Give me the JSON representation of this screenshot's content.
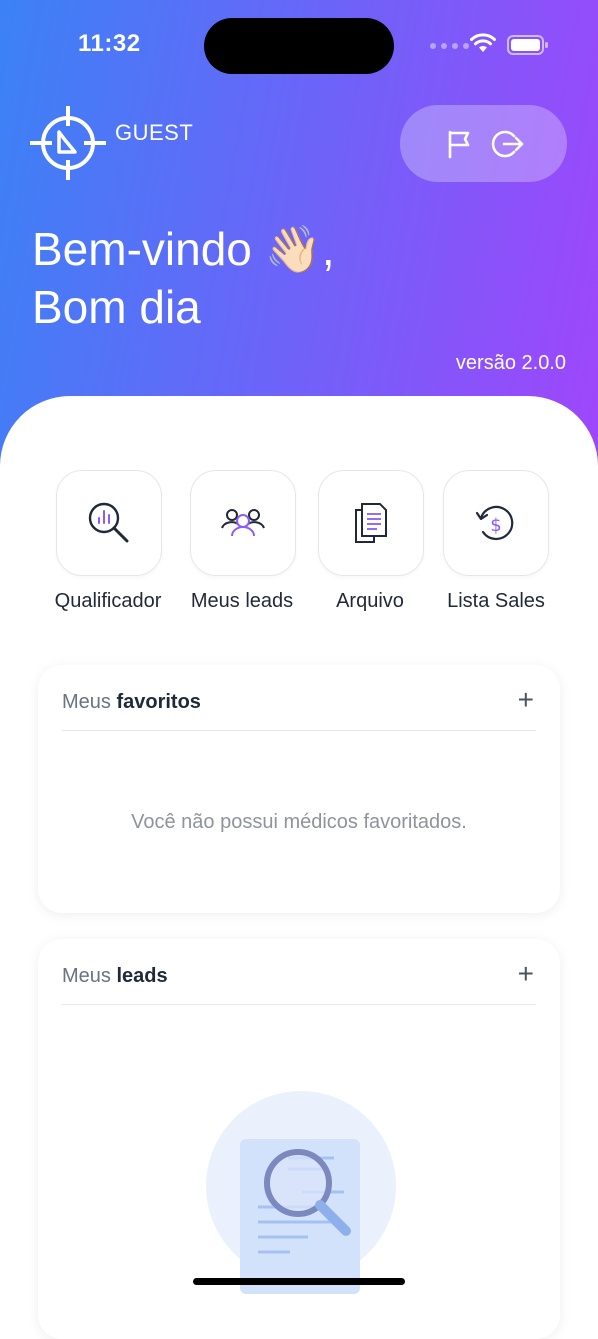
{
  "status_bar": {
    "time": "11:32"
  },
  "header": {
    "app_label": "GUEST",
    "greeting_line1": "Bem-vindo 👋🏻,",
    "greeting_line2": "Bom dia",
    "version": "versão 2.0.0",
    "gradient": [
      "#3b82f6",
      "#a145fb"
    ]
  },
  "icons": {
    "logo": "crosshair-logo-icon",
    "flag": "flag-icon",
    "logout": "logout-icon",
    "qualificador": "magnifier-chart-icon",
    "meus_leads": "people-group-icon",
    "arquivo": "documents-icon",
    "lista_sales": "dollar-history-icon"
  },
  "shortcuts": [
    {
      "label": "Qualificador"
    },
    {
      "label": "Meus leads"
    },
    {
      "label": "Arquivo"
    },
    {
      "label": "Lista Sales"
    }
  ],
  "favorites_card": {
    "title_prefix": "Meus ",
    "title_bold": "favoritos",
    "add": "+",
    "empty_message": "Você não possui médicos favoritados."
  },
  "leads_card": {
    "title_prefix": "Meus ",
    "title_bold": "leads",
    "add": "+"
  }
}
